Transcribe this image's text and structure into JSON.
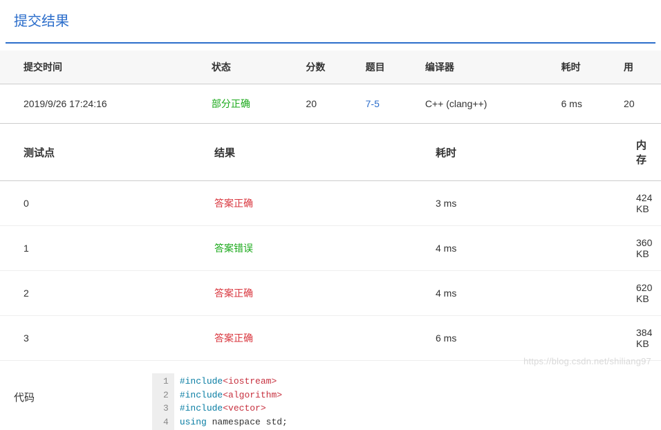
{
  "title": "提交结果",
  "summary": {
    "headers": {
      "time": "提交时间",
      "status": "状态",
      "score": "分数",
      "problem": "题目",
      "compiler": "编译器",
      "elapsed": "耗时",
      "memory": "用"
    },
    "row": {
      "time": "2019/9/26 17:24:16",
      "status": "部分正确",
      "score": "20",
      "problem": "7-5",
      "compiler": "C++ (clang++)",
      "elapsed": "6 ms",
      "memory": "20"
    }
  },
  "tests": {
    "headers": {
      "point": "测试点",
      "result": "结果",
      "time": "耗时",
      "memory": "内存"
    },
    "rows": [
      {
        "point": "0",
        "result": "答案正确",
        "resultKind": "correct",
        "time": "3 ms",
        "memory": "424 KB"
      },
      {
        "point": "1",
        "result": "答案错误",
        "resultKind": "wrong",
        "time": "4 ms",
        "memory": "360 KB"
      },
      {
        "point": "2",
        "result": "答案正确",
        "resultKind": "correct",
        "time": "4 ms",
        "memory": "620 KB"
      },
      {
        "point": "3",
        "result": "答案正确",
        "resultKind": "correct",
        "time": "6 ms",
        "memory": "384 KB"
      }
    ]
  },
  "code": {
    "label": "代码",
    "lines": [
      {
        "n": "1",
        "tokens": [
          [
            "kw-include",
            "#include"
          ],
          [
            "kw-header",
            "<iostream>"
          ]
        ]
      },
      {
        "n": "2",
        "tokens": [
          [
            "kw-include",
            "#include"
          ],
          [
            "kw-header",
            "<algorithm>"
          ]
        ]
      },
      {
        "n": "3",
        "tokens": [
          [
            "kw-include",
            "#include"
          ],
          [
            "kw-header",
            "<vector>"
          ]
        ]
      },
      {
        "n": "4",
        "tokens": [
          [
            "kw-using",
            "using"
          ],
          [
            "kw-ns",
            " namespace std;"
          ]
        ]
      }
    ]
  },
  "watermark": "https://blog.csdn.net/shiliang97"
}
